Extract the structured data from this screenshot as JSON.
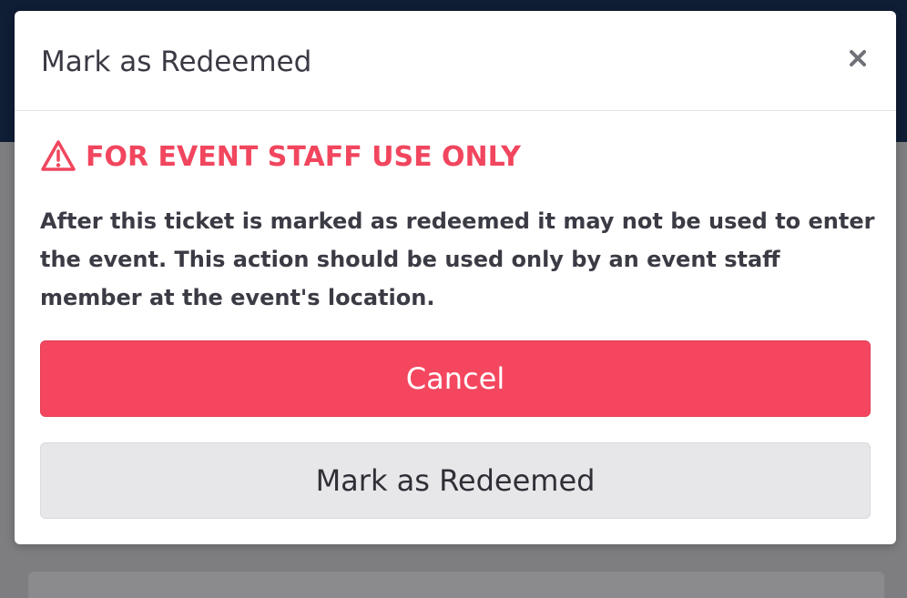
{
  "modal": {
    "title": "Mark as Redeemed",
    "close_icon": "close-icon",
    "warning": {
      "icon": "warning-triangle-icon",
      "text": "FOR EVENT STAFF USE ONLY",
      "color": "#f1465e"
    },
    "description": "After this ticket is marked as redeemed it may not be used to enter the event. This action should be used only by an event staff member at the event's location.",
    "buttons": {
      "cancel_label": "Cancel",
      "redeem_label": "Mark as Redeemed"
    }
  },
  "colors": {
    "danger": "#f4475f",
    "secondary_button": "#e7e7ea",
    "header_background": "#0f1d35"
  }
}
